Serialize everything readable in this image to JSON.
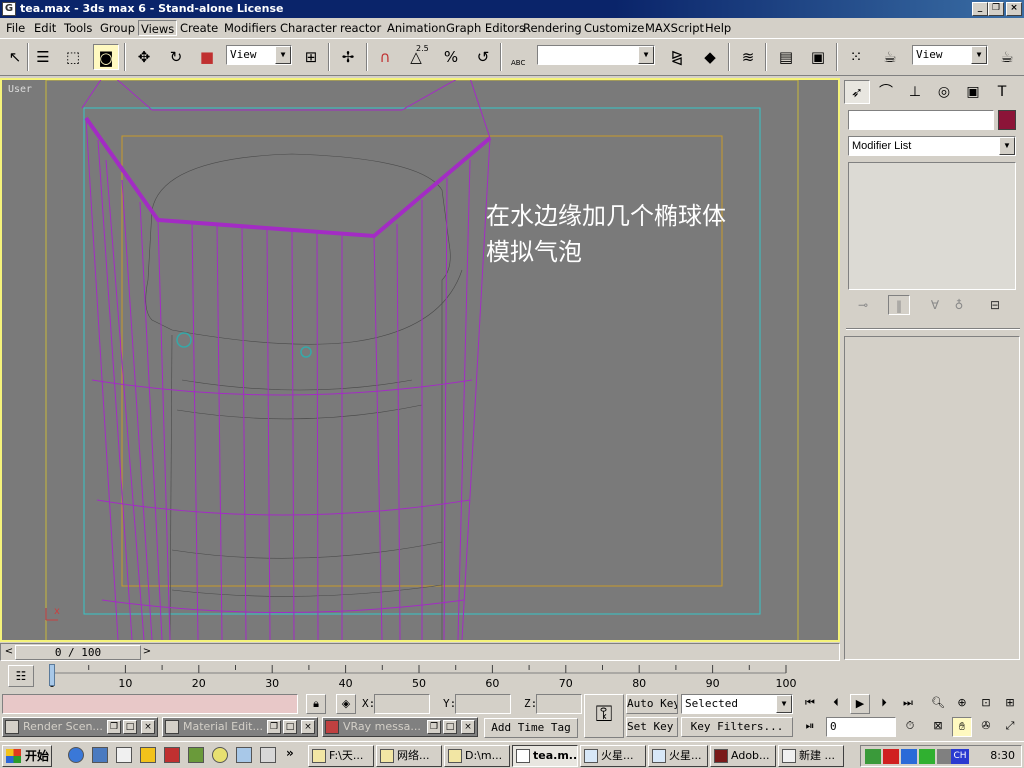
{
  "window": {
    "title": "tea.max - 3ds max 6 - Stand-alone License",
    "app_icon": "max-app-icon",
    "controls": [
      "_",
      "❐",
      "×"
    ]
  },
  "menu": [
    "File",
    "Edit",
    "Tools",
    "Group",
    "Views",
    "Create",
    "Modifiers",
    "Character",
    "reactor",
    "Animation",
    "Graph Editors",
    "Rendering",
    "Customize",
    "MAXScript",
    "Help"
  ],
  "menu_active": "Views",
  "toolbar": {
    "ref_coord": "View",
    "named_selection": "",
    "render_view": "View",
    "snap_25": "2.5",
    "percent_snap": "%",
    "mirror_abc": "ABC"
  },
  "viewport": {
    "label": "User",
    "annotation_line1": "在水边缘加几个椭球体",
    "annotation_line2": "模拟气泡",
    "axis_label": "x"
  },
  "command_panel": {
    "tabs": [
      "create",
      "modify",
      "hierarchy",
      "motion",
      "display",
      "utilities"
    ],
    "object_name": "",
    "object_color": "#8c1438",
    "modifier_list": "Modifier List"
  },
  "time_slider": {
    "current": "0 / 100",
    "prev": "<",
    "next": ">"
  },
  "trackbar": {
    "ticks": [
      "0",
      "10",
      "20",
      "30",
      "40",
      "50",
      "60",
      "70",
      "80",
      "90",
      "100"
    ]
  },
  "status": {
    "x_label": "X:",
    "y_label": "Y:",
    "z_label": "Z:",
    "x_value": "",
    "y_value": "",
    "z_value": "",
    "auto_key": "Auto Key",
    "set_key": "Set Key",
    "selection_filter": "Selected",
    "key_filters": "Key Filters...",
    "add_time_tag": "Add Time Tag",
    "frame": "0"
  },
  "minimized": [
    {
      "title": "Render Scen..."
    },
    {
      "title": "Material Edit..."
    },
    {
      "title": "VRay messa..."
    }
  ],
  "taskbar": {
    "start": "开始",
    "tasks": [
      "F:\\天...",
      "网络...",
      "D:\\m...",
      "tea.m...",
      "火星...",
      "火星...",
      "Adob...",
      "新建 ..."
    ],
    "active_task": "tea.m...",
    "lang": "CH",
    "clock": "8:30"
  }
}
